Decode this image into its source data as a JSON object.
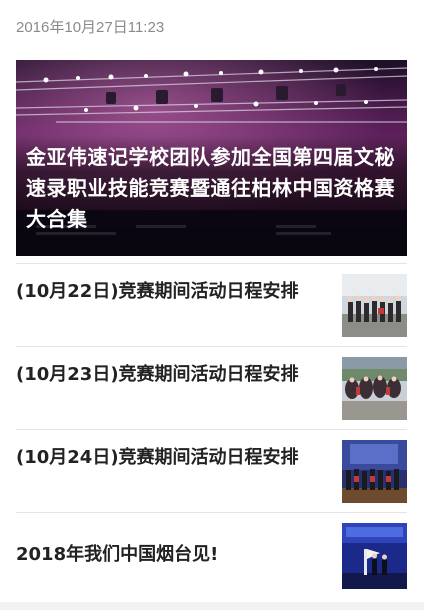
{
  "article": {
    "timestamp": "2016年10月27日11:23"
  },
  "hero": {
    "title": "金亚伟速记学校团队参加全国第四届文秘速录职业技能竞赛暨通往柏林中国资格赛大合集"
  },
  "list": [
    {
      "title": "(10月22日)竞赛期间活动日程安排"
    },
    {
      "title": "(10月23日)竞赛期间活动日程安排"
    },
    {
      "title": "(10月24日)竞赛期间活动日程安排"
    },
    {
      "title": "2018年我们中国烟台见!"
    }
  ]
}
